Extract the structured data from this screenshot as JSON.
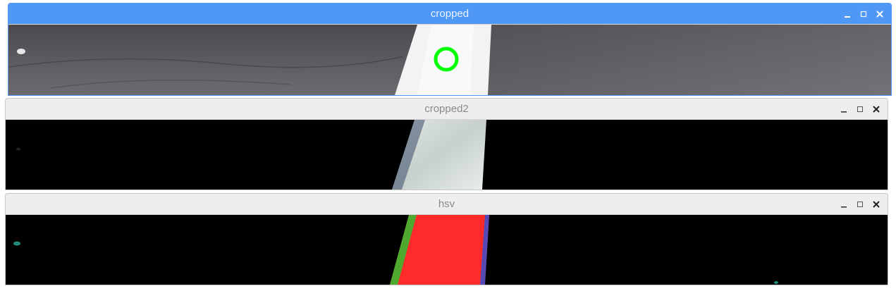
{
  "windows": [
    {
      "title": "cropped",
      "active": true
    },
    {
      "title": "cropped2",
      "active": false
    },
    {
      "title": "hsv",
      "active": false
    }
  ],
  "controls": {
    "minimize_icon": "minimize-icon",
    "maximize_icon": "maximize-icon",
    "close_icon": "close-icon"
  },
  "colors": {
    "active_titlebar": "#4f98f5",
    "inactive_titlebar": "#eeeeee",
    "detection_circle": "#00ff00",
    "hsv_mask": "#ff2a2a"
  }
}
